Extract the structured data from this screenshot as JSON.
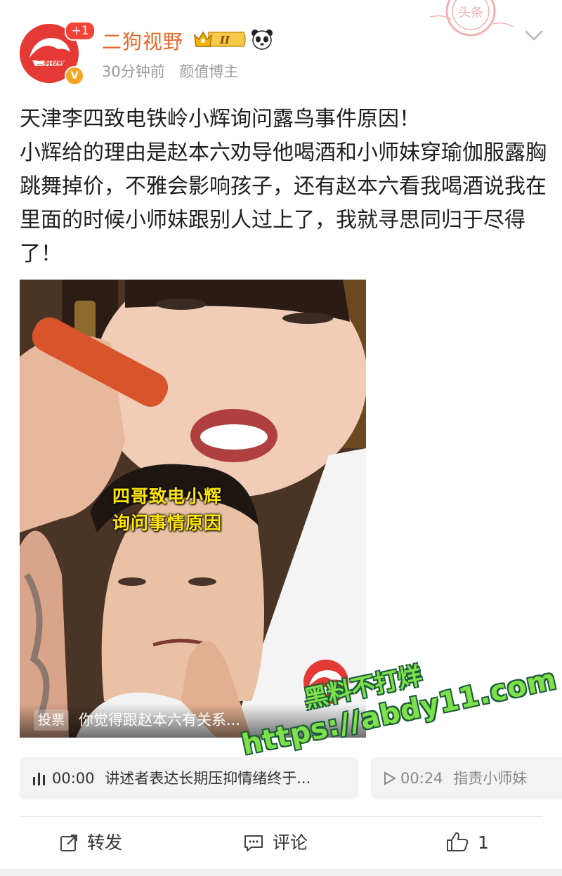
{
  "header": {
    "username": "二狗视野",
    "notification_count": "+1",
    "vip_level": "II",
    "time_ago": "30分钟前",
    "category": "颜值博主",
    "stamp_text": "头条"
  },
  "post": {
    "lines": [
      "天津李四致电铁岭小辉询问露鸟事件原因！",
      "小辉给的理由是赵本六劝导他喝酒和小师妹穿瑜伽服露胸跳舞掉价，不雅会影响孩子，还有赵本六看我喝酒说我在里面的时候小师妹跟别人过上了，我就寻思同归于尽得了！"
    ]
  },
  "video": {
    "caption_line1": "四哥致电小辉",
    "caption_line2": "询问事情原因",
    "poll_tag": "投票",
    "poll_question": "你觉得跟赵本六有关系...",
    "channel_logo_text": "二狗视野"
  },
  "watermark": {
    "line1": "黑料不打烊",
    "line2": "https://abdy11.com"
  },
  "audio": [
    {
      "time": "00:00",
      "title": "讲述者表达长期压抑情绪终于..."
    },
    {
      "time": "00:24",
      "title": "指责小师妹"
    }
  ],
  "actions": {
    "share_label": "转发",
    "comment_label": "评论",
    "like_count": "1"
  },
  "colors": {
    "username": "#e8692a",
    "brand_red": "#e53935",
    "watermark_green": "#7ee04a",
    "caption_yellow": "#ffe600"
  }
}
